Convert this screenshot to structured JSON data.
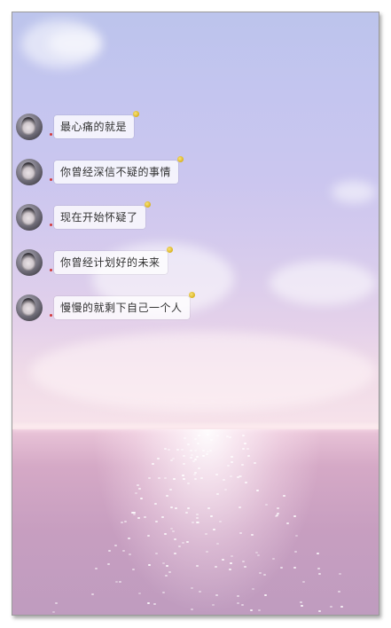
{
  "messages": [
    {
      "text": "最心痛的就是"
    },
    {
      "text": "你曾经深信不疑的事情"
    },
    {
      "text": "现在开始怀疑了"
    },
    {
      "text": "你曾经计划好的未来"
    },
    {
      "text": "慢慢的就剩下自己一个人"
    }
  ],
  "colors": {
    "bubble": "#ffffff",
    "text": "#333333",
    "unread_dot": "#d23a3a"
  },
  "icons": [
    "avatar",
    "emoji-icon",
    "unread-dot"
  ]
}
